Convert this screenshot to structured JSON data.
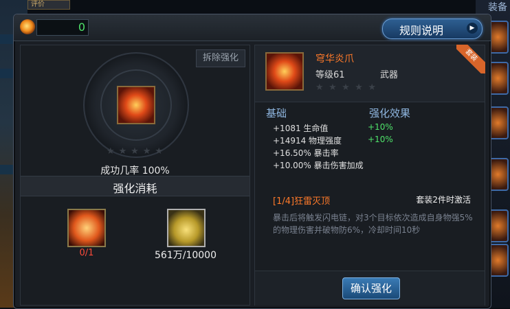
{
  "background": {
    "tag_label": "评价",
    "right_label": "装备"
  },
  "currency": {
    "icon": "fire-icon",
    "value": "0"
  },
  "rules_button": {
    "label": "规则说明"
  },
  "left": {
    "remove_button": "拆除强化",
    "success_rate": "成功几率 100%",
    "cost_title": "强化消耗",
    "materials": [
      {
        "icon": "enhance-stone-icon",
        "count": "0/1"
      },
      {
        "icon": "gold-coins-icon",
        "count": "561万/10000"
      }
    ]
  },
  "item": {
    "name": "穹华炎爪",
    "level": "等级61",
    "type": "武器",
    "ribbon": "套装",
    "stars_total": 5
  },
  "stats": {
    "base_header": "基础",
    "effect_header": "强化效果",
    "rows": [
      {
        "text": "+1081 生命值",
        "bonus": "+10%"
      },
      {
        "text": "+14914 物理强度",
        "bonus": "+10%"
      },
      {
        "text": "+16.50% 暴击率",
        "bonus": ""
      },
      {
        "text": "+10.00% 暴击伤害加成",
        "bonus": ""
      }
    ]
  },
  "set": {
    "title": "[1/4]狂雷灭顶",
    "activation": "套装2件时激活",
    "description": "暴击后将触发闪电链，对3个目标依次造成自身物强5%的物理伤害并破物防6%，冷却时间10秒"
  },
  "confirm_button": {
    "label": "确认强化"
  },
  "colors": {
    "accent_orange": "#ff7a2a",
    "bonus_green": "#4fe36a",
    "header_blue": "#8fb6e0",
    "warn_red": "#ff4a3a"
  }
}
